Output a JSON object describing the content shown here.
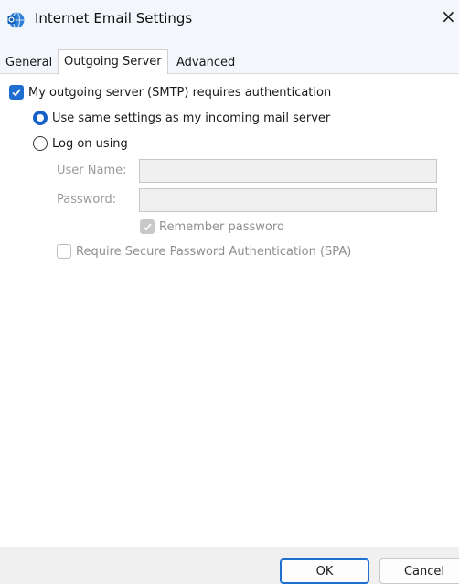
{
  "window": {
    "title": "Internet Email Settings",
    "close_glyph": "×",
    "icon": "outlook-globe-icon"
  },
  "tabs": [
    {
      "label": "General",
      "active": false
    },
    {
      "label": "Outgoing Server",
      "active": true
    },
    {
      "label": "Advanced",
      "active": false
    }
  ],
  "outgoing": {
    "smtp_auth_label": "My outgoing server (SMTP) requires authentication",
    "smtp_auth_checked": true,
    "same_settings_label": "Use same settings as my incoming mail server",
    "same_settings_selected": true,
    "logon_label": "Log on using",
    "logon_selected": false,
    "username_label": "User Name:",
    "username_value": "",
    "password_label": "Password:",
    "password_value": "",
    "remember_label": "Remember password",
    "remember_checked": true,
    "spa_label": "Require Secure Password Authentication (SPA)",
    "spa_checked": false
  },
  "buttons": {
    "ok_label": "OK",
    "cancel_label": "Cancel"
  },
  "colors": {
    "accent": "#1f6fd1",
    "disabled_text": "#9a9a9a"
  }
}
